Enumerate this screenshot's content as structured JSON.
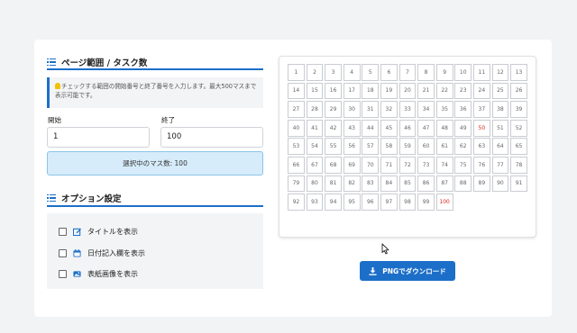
{
  "page_range": {
    "title": "ページ範囲 / タスク数",
    "info": "チェックする範囲の開始番号と終了番号を入力します。最大500マスまで表示可能です。",
    "start_label": "開始",
    "start_value": "1",
    "end_label": "終了",
    "end_value": "100",
    "count_text": "選択中のマス数: 100"
  },
  "options": {
    "title": "オプション設定",
    "items": [
      {
        "label": "タイトルを表示",
        "icon": "edit-icon",
        "checked": false
      },
      {
        "label": "日付記入欄を表示",
        "icon": "calendar-icon",
        "checked": false
      },
      {
        "label": "表紙画像を表示",
        "icon": "image-icon",
        "checked": false
      }
    ]
  },
  "preview": {
    "start": 1,
    "end": 100,
    "highlight": [
      50,
      100
    ],
    "highlight_color": "#d9281e"
  },
  "download": {
    "label": "PNGでダウンロード",
    "icon": "download-icon"
  },
  "colors": {
    "accent": "#1c6fc9",
    "count_bg": "#d6ecfa",
    "background": "#f2f3f5"
  }
}
